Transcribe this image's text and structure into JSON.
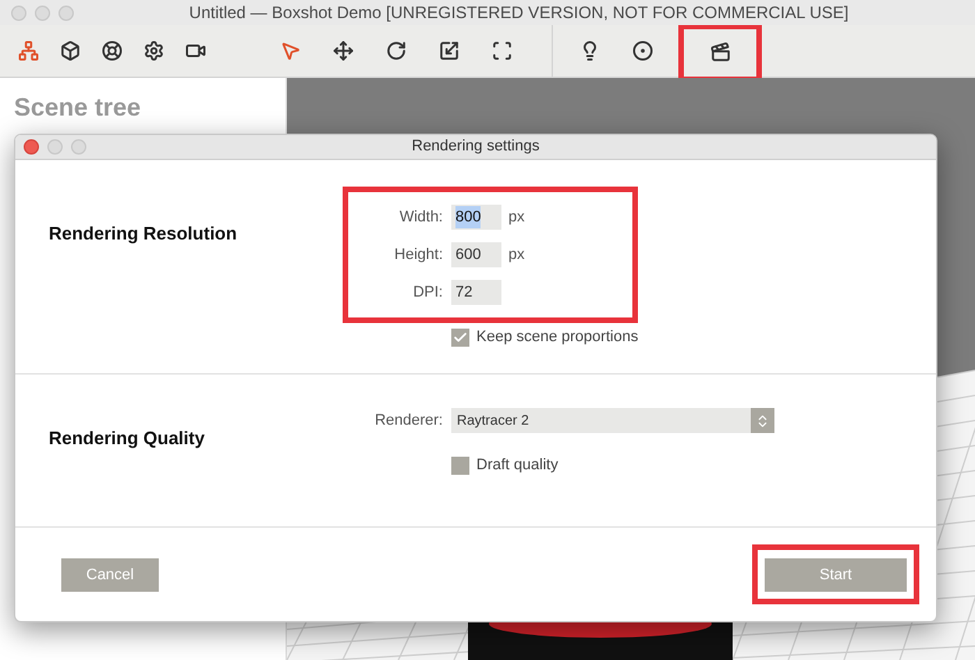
{
  "window": {
    "title": "Untitled — Boxshot Demo [UNREGISTERED VERSION, NOT FOR COMMERCIAL USE]"
  },
  "toolbar": {
    "groups": [
      {
        "tools": [
          {
            "selected": true,
            "highlighted": false
          },
          {
            "selected": false,
            "highlighted": false
          },
          {
            "selected": false,
            "highlighted": false
          },
          {
            "selected": false,
            "highlighted": false
          },
          {
            "selected": false,
            "highlighted": false
          }
        ]
      },
      {
        "tools": [
          {
            "selected": true,
            "highlighted": false
          },
          {
            "selected": false,
            "highlighted": false
          },
          {
            "selected": false,
            "highlighted": false
          },
          {
            "selected": false,
            "highlighted": false
          },
          {
            "selected": false,
            "highlighted": false
          }
        ]
      },
      {
        "tools": [
          {
            "selected": false,
            "highlighted": false
          },
          {
            "selected": false,
            "highlighted": false
          },
          {
            "selected": false,
            "highlighted": true
          }
        ]
      }
    ]
  },
  "sidebar": {
    "title": "Scene tree"
  },
  "dialog": {
    "title": "Rendering settings",
    "sections": [
      {
        "heading": "Rendering Resolution",
        "highlighted": true,
        "fields": [
          {
            "kind": "number",
            "label": "Width:",
            "value": "800",
            "unit": "px",
            "text_selected": true
          },
          {
            "kind": "number",
            "label": "Height:",
            "value": "600",
            "unit": "px",
            "text_selected": false
          },
          {
            "kind": "number",
            "label": "DPI:",
            "value": "72",
            "text_selected": false
          }
        ],
        "checkbox": {
          "label": "Keep scene proportions",
          "checked": true
        }
      },
      {
        "heading": "Rendering Quality",
        "highlighted": false,
        "fields": [
          {
            "kind": "select",
            "label": "Renderer:",
            "value": "Raytracer 2"
          }
        ],
        "checkbox": {
          "label": "Draft quality",
          "checked": false
        }
      }
    ],
    "buttons": [
      {
        "label": "Cancel",
        "highlighted": false
      },
      {
        "label": "Start",
        "highlighted": true
      }
    ]
  }
}
